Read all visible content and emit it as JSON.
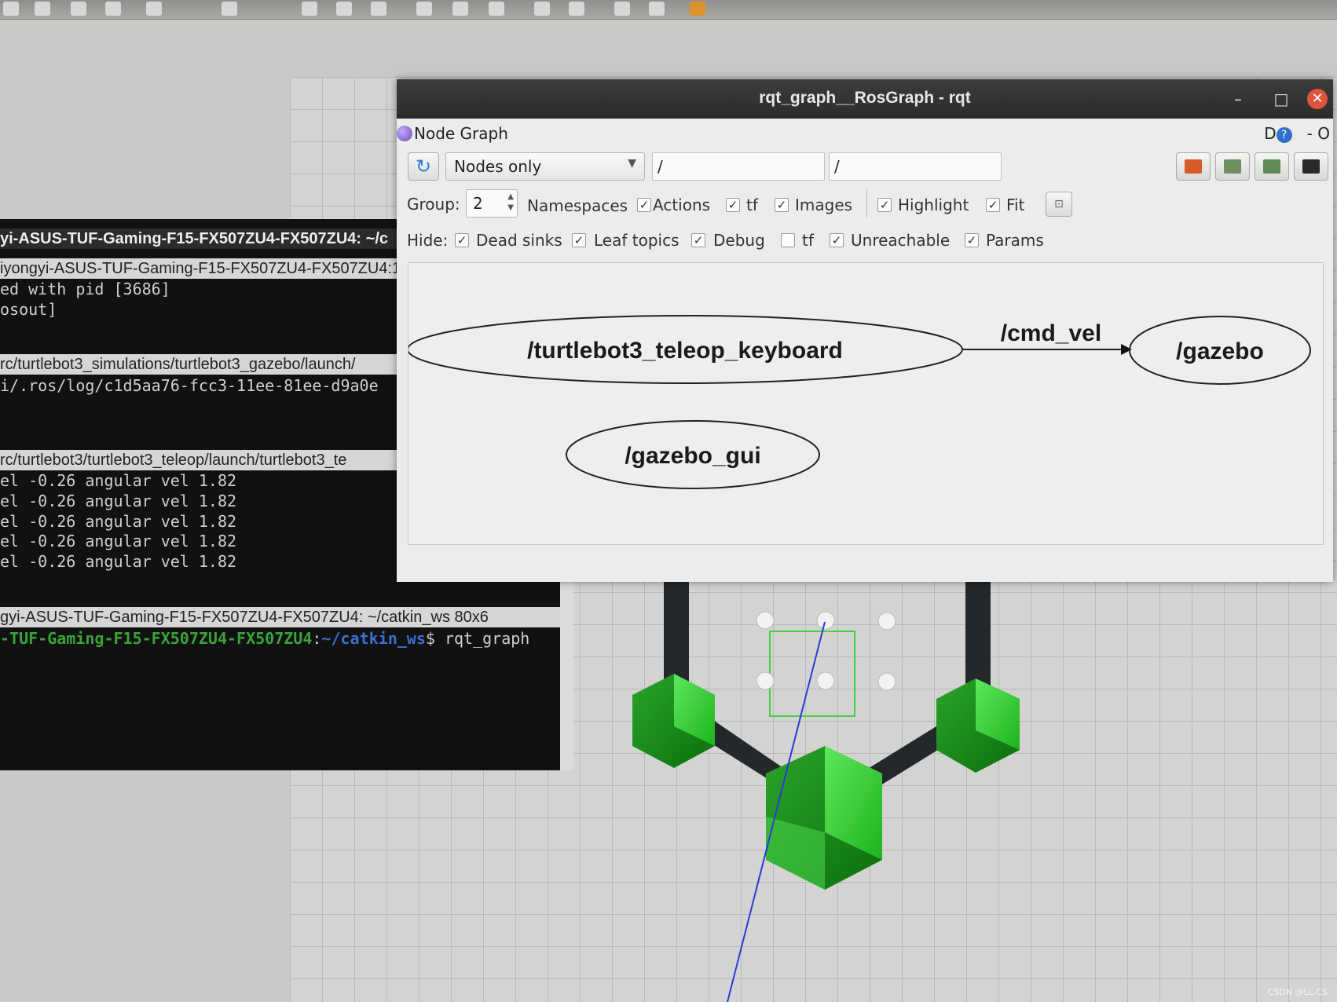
{
  "rqt_window": {
    "title": "rqt_graph__RosGraph - rqt",
    "minimize": "–",
    "maximize": "□",
    "close": "✕"
  },
  "panel": {
    "title": "Node Graph",
    "right_d": "D",
    "right_help": "?",
    "right_dash": "-",
    "right_o": "O"
  },
  "toolbar": {
    "mode": "Nodes only",
    "filter1": "/",
    "filter2": "/"
  },
  "options": {
    "group_label": "Group:",
    "group_value": "2",
    "namespaces": "Namespaces",
    "actions": "Actions",
    "tf": "tf",
    "images": "Images",
    "highlight": "Highlight",
    "fit": "Fit"
  },
  "hide": {
    "label": "Hide:",
    "dead_sinks": "Dead sinks",
    "leaf_topics": "Leaf topics",
    "debug": "Debug",
    "tf": "tf",
    "unreachable": "Unreachable",
    "params": "Params"
  },
  "graph": {
    "nodes": [
      "/turtlebot3_teleop_keyboard",
      "/gazebo",
      "/gazebo_gui"
    ],
    "edge_label": "/cmd_vel"
  },
  "terminal": {
    "tab1_title": "yi-ASUS-TUF-Gaming-F15-FX507ZU4-FX507ZU4: ~/c",
    "tab2_bar": "iyongyi-ASUS-TUF-Gaming-F15-FX507ZU4-FX507ZU4:1",
    "line1": "ed with pid [3686]",
    "line2": "osout]",
    "bar3": "rc/turtlebot3_simulations/turtlebot3_gazebo/launch/",
    "line3": "i/.ros/log/c1d5aa76-fcc3-11ee-81ee-d9a0e",
    "bar4": "rc/turtlebot3/turtlebot3_teleop/launch/turtlebot3_te",
    "vel_lines": [
      "el -0.26         angular vel 1.82",
      "el -0.26         angular vel 1.82",
      "el -0.26         angular vel 1.82",
      "el -0.26         angular vel 1.82",
      "el -0.26         angular vel 1.82"
    ],
    "bar5": "gyi-ASUS-TUF-Gaming-F15-FX507ZU4-FX507ZU4: ~/catkin_ws 80x6",
    "prompt_host": "-TUF-Gaming-F15-FX507ZU4-FX507ZU4",
    "prompt_sep": ":",
    "prompt_path": "~/catkin_ws",
    "prompt_cmd": "$ rqt_graph"
  },
  "watermark": "CSDN @LL.CS",
  "colors": {
    "robot_green": "#2fb52f",
    "close_red": "#e0533c",
    "select_box": "#43d043"
  }
}
